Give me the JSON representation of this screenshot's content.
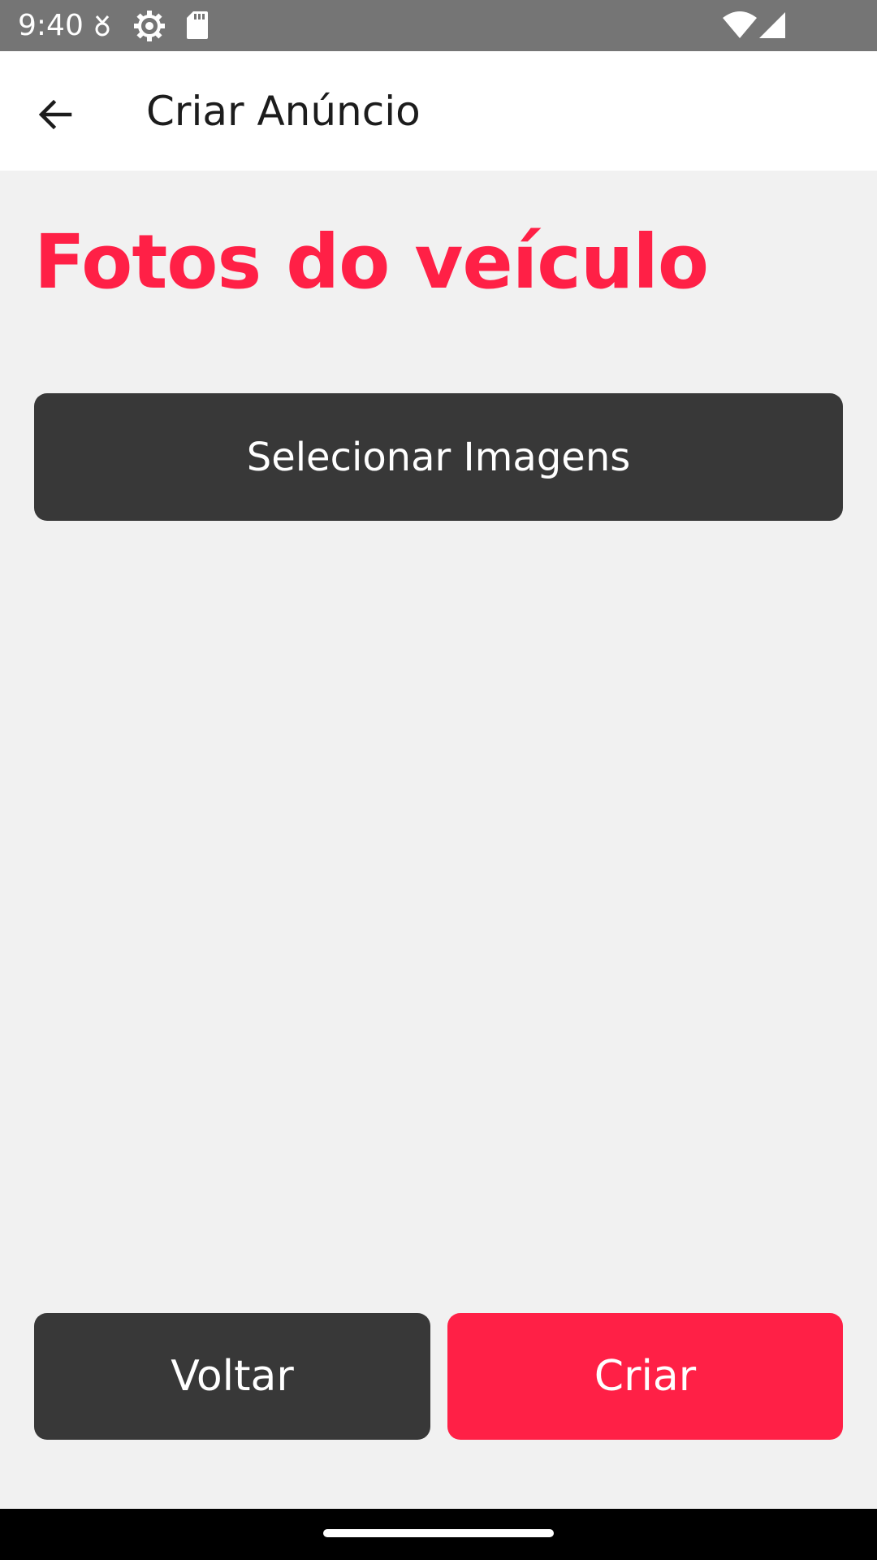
{
  "status_bar": {
    "time": "9:40",
    "icons": [
      "data-saver-icon",
      "settings-gear-icon",
      "sd-card-icon",
      "wifi-icon",
      "cell-signal-icon"
    ]
  },
  "app_bar": {
    "back_icon": "arrow-back-icon",
    "title": "Criar Anúncio"
  },
  "content": {
    "section_title": "Fotos do veículo",
    "select_images_label": "Selecionar Imagens"
  },
  "footer": {
    "back_label": "Voltar",
    "create_label": "Criar"
  },
  "colors": {
    "accent": "#ff2046",
    "dark_button": "#383838",
    "status_bar": "#757575",
    "background": "#f1f1f1"
  }
}
